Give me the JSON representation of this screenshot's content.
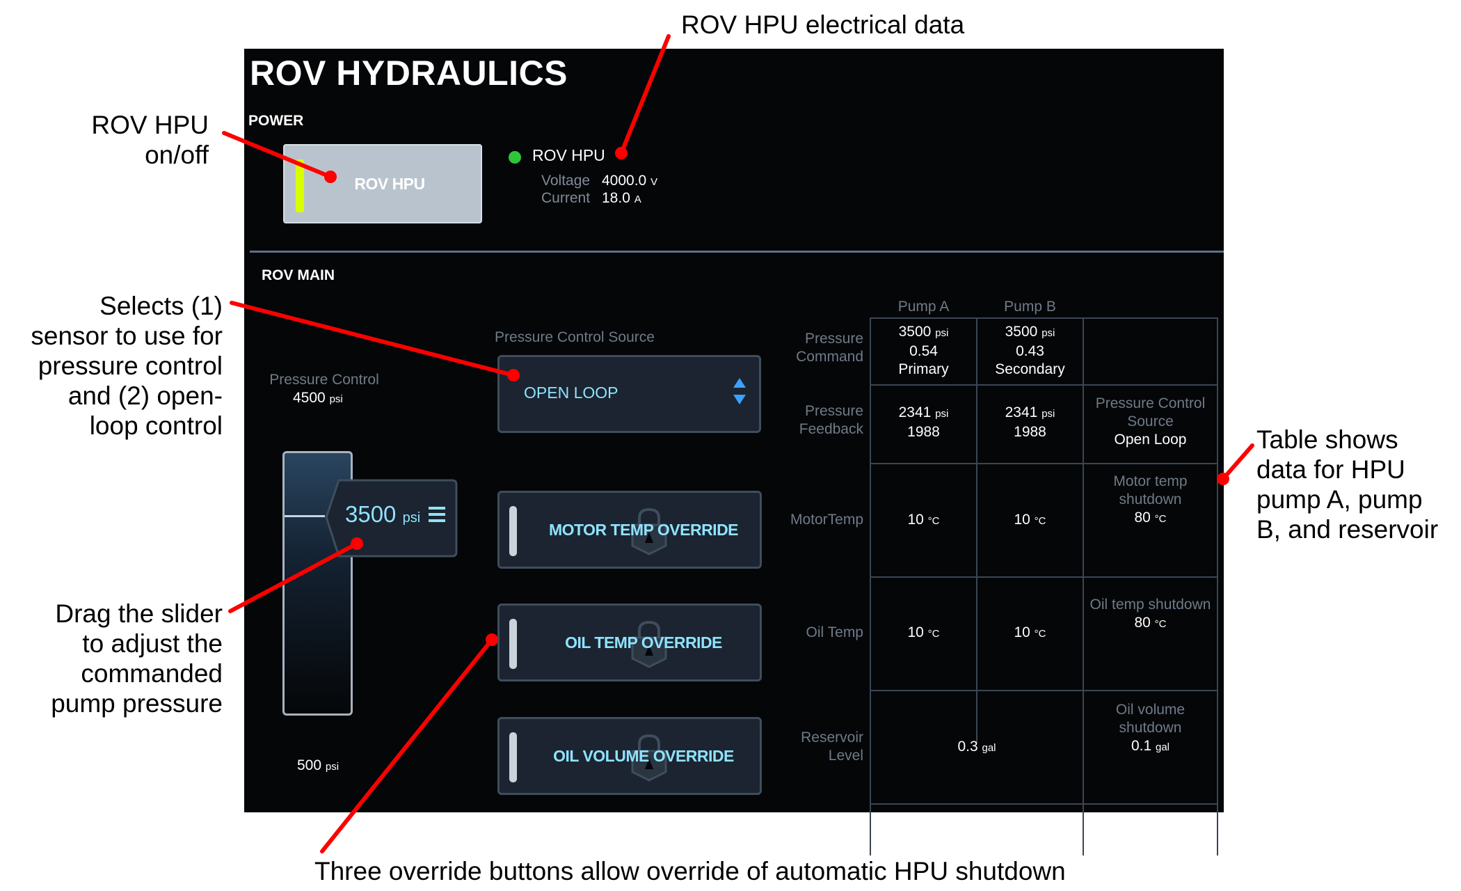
{
  "panel": {
    "title": "ROV HYDRAULICS",
    "power_label": "POWER",
    "hpu_button_label": "ROV HPU",
    "hpu_status": {
      "name": "ROV HPU",
      "status_color": "#2fc53a",
      "voltage_label": "Voltage",
      "voltage_value": "4000.0",
      "voltage_unit": "V",
      "current_label": "Current",
      "current_value": "18.0",
      "current_unit": "A"
    },
    "rov_main_label": "ROV MAIN",
    "pressure_control": {
      "label": "Pressure Control",
      "max_value": "4500",
      "max_unit": "psi",
      "min_value": "500",
      "min_unit": "psi",
      "slider_value": "3500",
      "slider_unit": "psi"
    },
    "pressure_control_source": {
      "label": "Pressure Control Source",
      "selected": "OPEN LOOP"
    },
    "overrides": [
      {
        "label": "MOTOR TEMP OVERRIDE"
      },
      {
        "label": "OIL TEMP OVERRIDE"
      },
      {
        "label": "OIL VOLUME OVERRIDE"
      }
    ],
    "table": {
      "col_headers": [
        "Pump A",
        "Pump B"
      ],
      "row_labels": {
        "pressure_command": [
          "Pressure",
          "Command"
        ],
        "pressure_feedback": [
          "Pressure",
          "Feedback"
        ],
        "motor_temp": "MotorTemp",
        "oil_temp": "Oil Temp",
        "reservoir": [
          "Reservoir",
          "Level"
        ]
      },
      "pressure_command": {
        "a": {
          "psi": "3500",
          "ratio": "0.54",
          "role": "Primary"
        },
        "b": {
          "psi": "3500",
          "ratio": "0.43",
          "role": "Secondary"
        }
      },
      "pressure_feedback": {
        "a": {
          "psi": "2341",
          "raw": "1988"
        },
        "b": {
          "psi": "2341",
          "raw": "1988"
        },
        "source_label": [
          "Pressure Control",
          "Source"
        ],
        "source_value": "Open Loop"
      },
      "motor_temp": {
        "a": "10",
        "b": "10",
        "shutdown_label": [
          "Motor temp",
          "shutdown"
        ],
        "shutdown_value": "80"
      },
      "oil_temp": {
        "a": "10",
        "b": "10",
        "shutdown_label": "Oil temp shutdown",
        "shutdown_value": "80"
      },
      "reservoir": {
        "level": "0.3",
        "shutdown_label": [
          "Oil volume",
          "shutdown"
        ],
        "shutdown_value": "0.1"
      },
      "units": {
        "psi": "psi",
        "temp": "°C",
        "gal": "gal"
      }
    }
  },
  "annotations": {
    "electrical": "ROV HPU electrical data",
    "onoff": [
      "ROV HPU",
      "on/off"
    ],
    "selects": [
      "Selects (1)",
      "sensor to use for",
      "pressure control",
      "and (2) open-",
      "loop control"
    ],
    "table": [
      "Table shows",
      "data for HPU",
      "pump A, pump",
      "B, and reservoir"
    ],
    "slider": [
      "Drag the slider",
      "to adjust the",
      "commanded",
      "pump pressure"
    ],
    "overrides": "Three override buttons allow override of automatic HPU shutdown"
  }
}
